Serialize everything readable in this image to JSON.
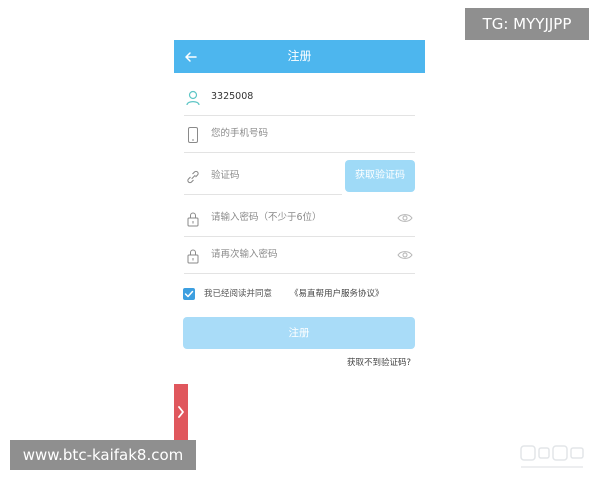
{
  "overlay": {
    "tg": "TG: MYYJJPP",
    "url": "www.btc-kaifak8.com"
  },
  "header": {
    "title": "注册",
    "back_icon": "arrow-left-icon",
    "color": "#4db6ee"
  },
  "form": {
    "username": {
      "value": "3325008",
      "icon": "user-icon"
    },
    "phone": {
      "placeholder": "您的手机号码",
      "icon": "phone-icon"
    },
    "code": {
      "placeholder": "验证码",
      "icon": "link-icon",
      "button": "获取验证码"
    },
    "password": {
      "placeholder": "请输入密码（不少于6位）",
      "icon": "lock-icon",
      "eye_icon": "eye-icon"
    },
    "confirm": {
      "placeholder": "请再次输入密码",
      "icon": "lock-icon",
      "eye_icon": "eye-icon"
    }
  },
  "agreement": {
    "checked": true,
    "text": "我已经阅读并同意",
    "link": "《易直帮用户服务协议》"
  },
  "actions": {
    "register": "注册",
    "no_code": "获取不到验证码?"
  },
  "side_tab": {
    "icon": "chevron-right-icon",
    "color": "#e0575d"
  }
}
